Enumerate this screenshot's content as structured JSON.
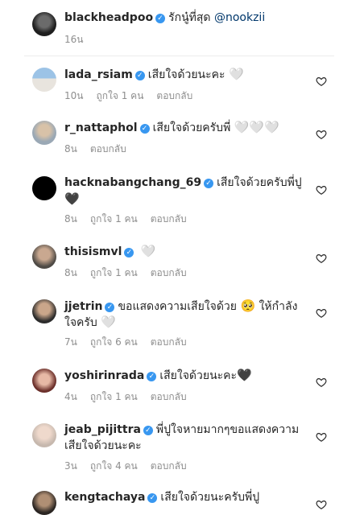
{
  "caption": {
    "username": "blackheadpoo",
    "text": "รักนู๋ที่สุด",
    "mention": "@nookzii",
    "time": "16น"
  },
  "comments": [
    {
      "username": "lada_rsiam",
      "text": "เสียใจด้วยนะคะ",
      "emoji": "🤍",
      "emoji2": "",
      "time": "10น",
      "likes": "ถูกใจ 1 คน",
      "reply": "ตอบกลับ"
    },
    {
      "username": "r_nattaphol",
      "text": "เสียใจด้วยครับพี่",
      "emoji": "🤍🤍🤍",
      "emoji2": "",
      "time": "8น",
      "likes": "",
      "reply": "ตอบกลับ"
    },
    {
      "username": "hacknabangchang_69",
      "text": "เสียใจด้วยครับพี่ปู",
      "emoji": "🖤",
      "emoji2": "",
      "time": "8น",
      "likes": "ถูกใจ 1 คน",
      "reply": "ตอบกลับ"
    },
    {
      "username": "thisismvl",
      "text": "",
      "emoji": "🤍",
      "emoji2": "",
      "time": "8น",
      "likes": "ถูกใจ 1 คน",
      "reply": "ตอบกลับ"
    },
    {
      "username": "jjetrin",
      "text": "ขอแสดงความเสียใจด้วย",
      "emoji": "🥺",
      "text2": "ให้กำลัง",
      "text3": "ใจครับ",
      "emoji2": "🤍",
      "time": "7น",
      "likes": "ถูกใจ 6 คน",
      "reply": "ตอบกลับ"
    },
    {
      "username": "yoshirinrada",
      "text": "เสียใจด้วยนะคะ",
      "emoji": "🖤",
      "emoji2": "",
      "time": "4น",
      "likes": "ถูกใจ 1 คน",
      "reply": "ตอบกลับ"
    },
    {
      "username": "jeab_pijittra",
      "text": "พี่ปูใจหายมากๆขอแสดงความ",
      "text3": "เสียใจด้วยนะคะ",
      "emoji": "",
      "emoji2": "",
      "time": "3น",
      "likes": "ถูกใจ 4 คน",
      "reply": "ตอบกลับ"
    },
    {
      "username": "kengtachaya",
      "text": "เสียใจด้วยนะครับพี่ปู",
      "emoji": "",
      "emoji2": "",
      "time": "",
      "likes": "",
      "reply": ""
    }
  ],
  "verified_badge": "✓",
  "colors": {
    "verified": "#3897f0",
    "meta": "#8e8e8e",
    "mention": "#00376b"
  },
  "icons": {
    "like": "heart-outline-icon"
  }
}
